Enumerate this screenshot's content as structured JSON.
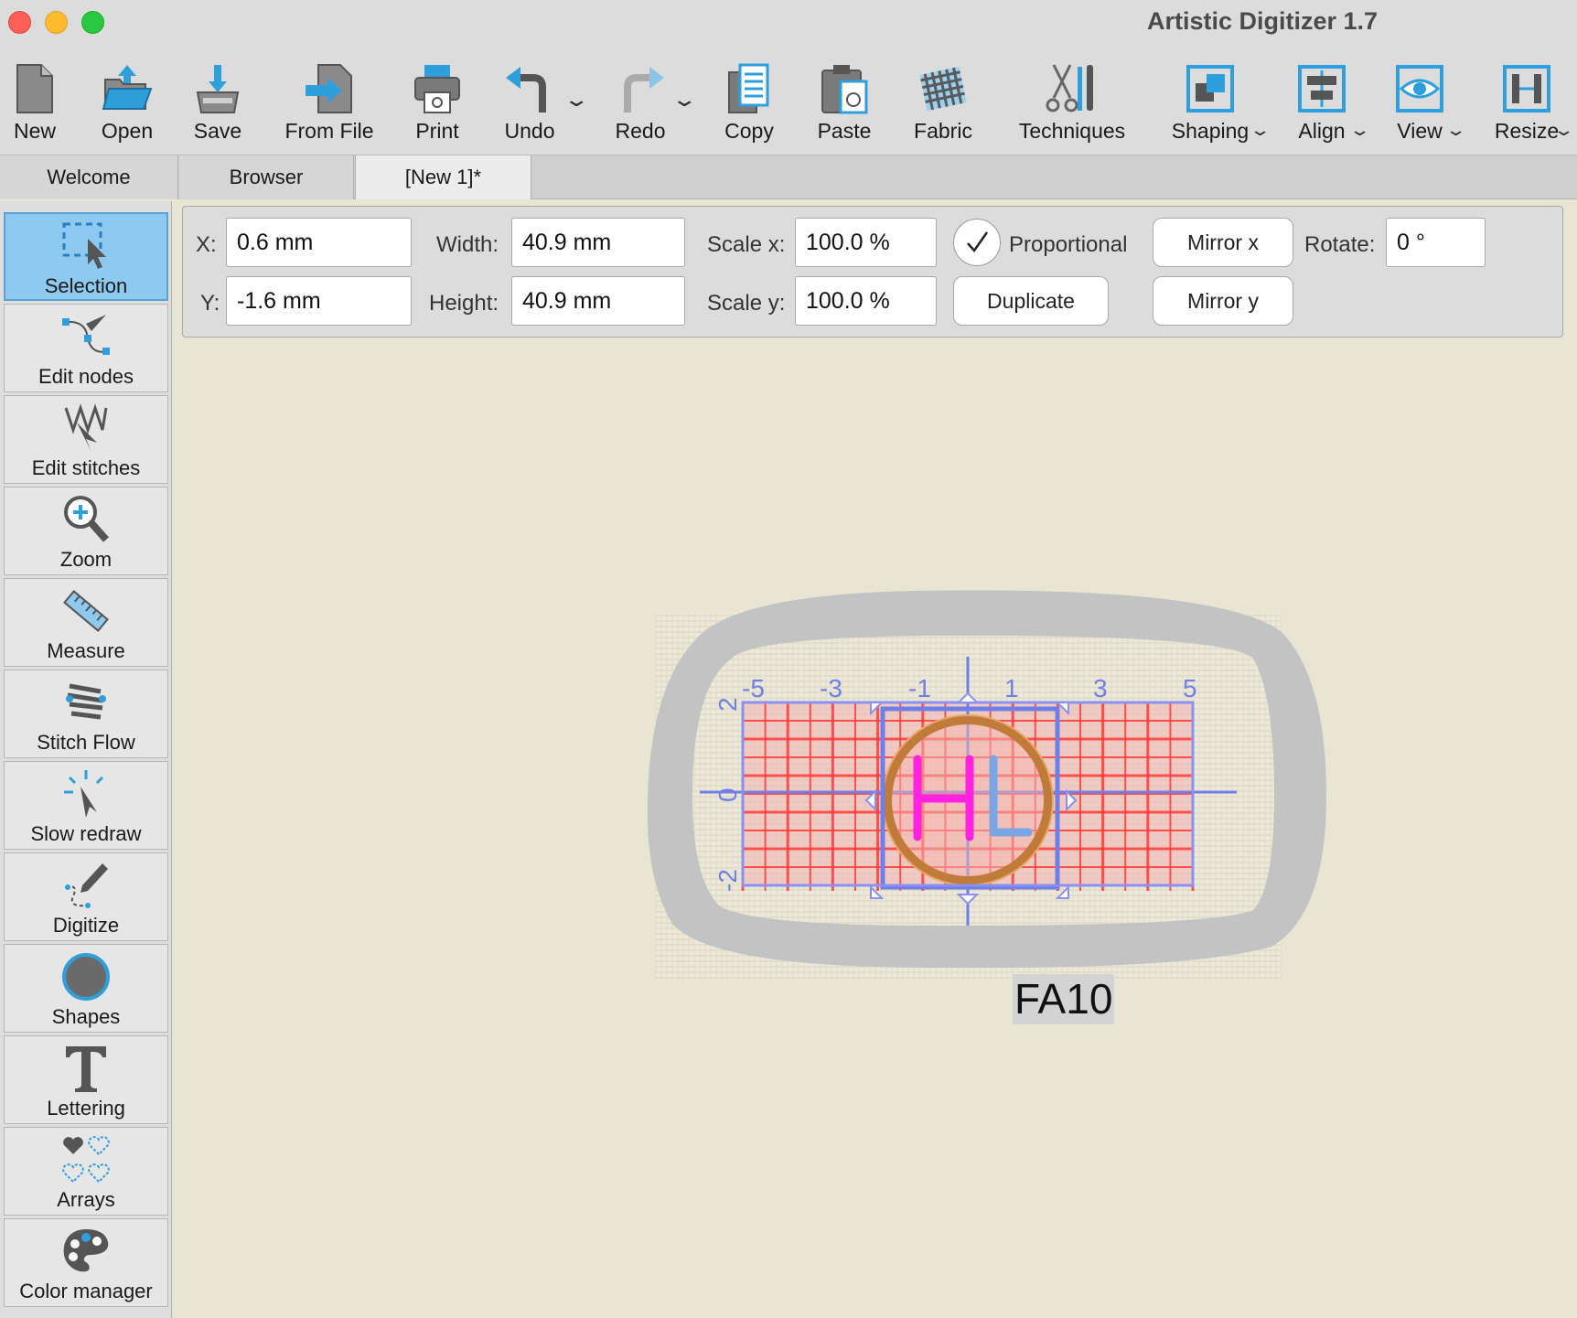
{
  "app": {
    "title": "Artistic Digitizer 1.7"
  },
  "toolbar": {
    "new": "New",
    "open": "Open",
    "save": "Save",
    "from_file": "From File",
    "print": "Print",
    "undo": "Undo",
    "redo": "Redo",
    "copy": "Copy",
    "paste": "Paste",
    "fabric": "Fabric",
    "techniques": "Techniques",
    "shaping": "Shaping",
    "align": "Align",
    "view": "View",
    "resize": "Resize"
  },
  "tabs": [
    {
      "label": "Welcome"
    },
    {
      "label": "Browser"
    },
    {
      "label": "[New 1]*"
    }
  ],
  "tools": [
    {
      "label": "Selection",
      "icon": "selection-icon"
    },
    {
      "label": "Edit nodes",
      "icon": "edit-nodes-icon"
    },
    {
      "label": "Edit stitches",
      "icon": "edit-stitches-icon"
    },
    {
      "label": "Zoom",
      "icon": "zoom-icon"
    },
    {
      "label": "Measure",
      "icon": "measure-icon"
    },
    {
      "label": "Stitch Flow",
      "icon": "stitch-flow-icon"
    },
    {
      "label": "Slow redraw",
      "icon": "slow-redraw-icon"
    },
    {
      "label": "Digitize",
      "icon": "digitize-icon"
    },
    {
      "label": "Shapes",
      "icon": "shapes-icon"
    },
    {
      "label": "Lettering",
      "icon": "lettering-icon"
    },
    {
      "label": "Arrays",
      "icon": "arrays-icon"
    },
    {
      "label": "Color manager",
      "icon": "color-manager-icon"
    }
  ],
  "props": {
    "x_label": "X:",
    "x_value": "0.6 mm",
    "y_label": "Y:",
    "y_value": "-1.6 mm",
    "width_label": "Width:",
    "width_value": "40.9 mm",
    "height_label": "Height:",
    "height_value": "40.9 mm",
    "scalex_label": "Scale x:",
    "scalex_value": "100.0 %",
    "scaley_label": "Scale y:",
    "scaley_value": "100.0 %",
    "proportional_label": "Proportional",
    "proportional_checked": true,
    "duplicate_label": "Duplicate",
    "mirror_x_label": "Mirror x",
    "mirror_y_label": "Mirror y",
    "rotate_label": "Rotate:",
    "rotate_value": "0 °"
  },
  "canvas": {
    "hoop_name": "FA10",
    "ruler_x_ticks": [
      "-5",
      "-3",
      "-1",
      "1",
      "3",
      "5"
    ],
    "ruler_y_ticks": [
      "2",
      "0",
      "-2"
    ],
    "design_letters": "HL"
  },
  "colors": {
    "accent": "#2f9fdc",
    "selection_blue": "#6f7fe6",
    "grid_red": "#ff3b3b",
    "letters_magenta": "#ff22e0",
    "hoop_gray": "#c3c3c3"
  }
}
